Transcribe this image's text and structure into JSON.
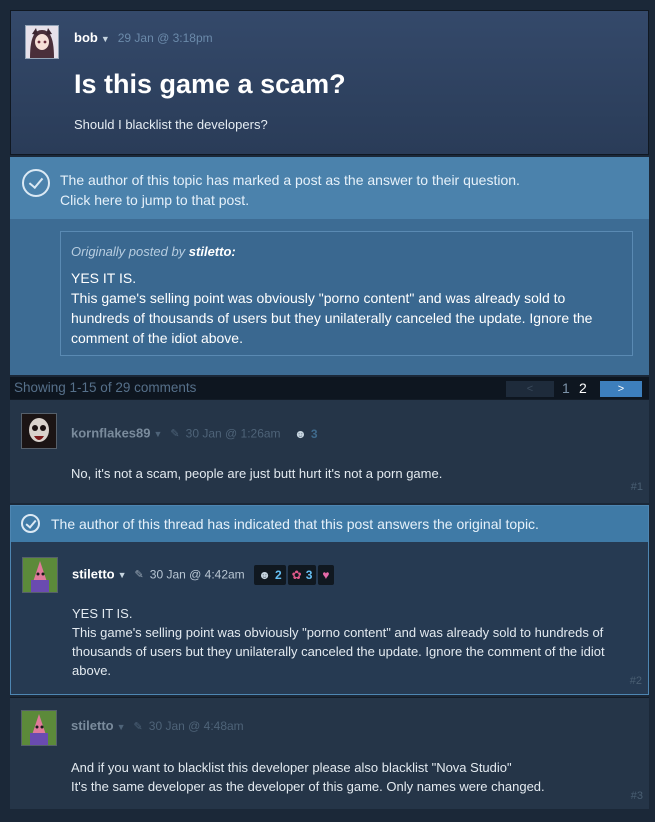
{
  "topic": {
    "author": "bob",
    "date": "29 Jan @ 3:18pm",
    "title": "Is this game a scam?",
    "description": "Should I blacklist the developers?"
  },
  "answer_notice": {
    "line1": "The author of this topic has marked a post as the answer to their question.",
    "line2": "Click here to jump to that post.",
    "quote_prefix": "Originally posted by",
    "quote_author": "stiletto:",
    "quote_line1": "YES IT IS.",
    "quote_line2": "This game's selling point was obviously \"porno content\" and was already sold to hundreds of thousands of users but they unilaterally canceled the update. Ignore the comment of the idiot above."
  },
  "paging": {
    "summary": "Showing 1-15 of 29 comments",
    "prev": "<",
    "page1": "1",
    "page2": "2",
    "next": ">"
  },
  "comments": [
    {
      "author": "kornflakes89",
      "date": "30 Jan @ 1:26am",
      "badge_count": "3",
      "text": "No, it's not a scam, people are just butt hurt it's not a porn game.",
      "number": "#1"
    },
    {
      "answer_banner": "The author of this thread has indicated that this post answers the original topic.",
      "author": "stiletto",
      "date": "30 Jan @ 4:42am",
      "badge1_count": "2",
      "badge2_count": "3",
      "line1": "YES IT IS.",
      "line2": "This game's selling point was obviously \"porno content\" and was already sold to hundreds of thousands of users but they unilaterally canceled the update. Ignore the comment of the idiot above.",
      "number": "#2"
    },
    {
      "author": "stiletto",
      "date": "30 Jan @ 4:48am",
      "line1": "And if you want to blacklist this developer please also blacklist \"Nova Studio\"",
      "line2": "It's the same developer as the developer of this game. Only names were changed.",
      "number": "#3"
    }
  ],
  "icons": {
    "caret": "▼",
    "edit": "pencil-icon"
  }
}
